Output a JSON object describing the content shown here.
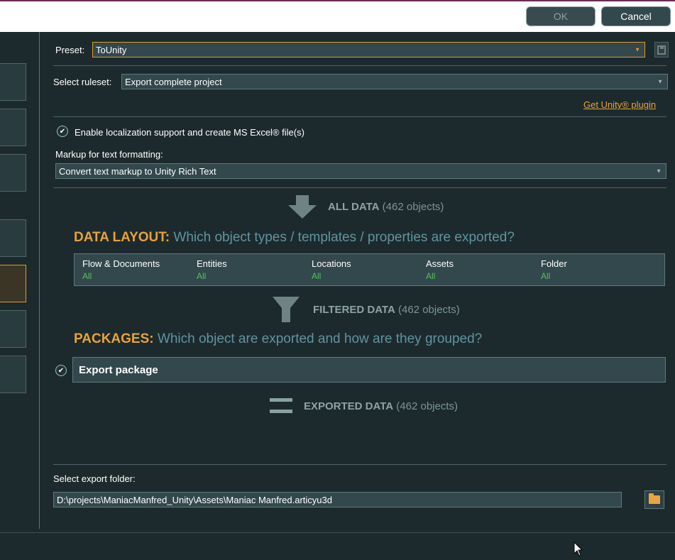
{
  "window": {
    "minimize_glyph": "−",
    "close_glyph": "✕"
  },
  "preset": {
    "label": "Preset:",
    "value": "ToUnity"
  },
  "ruleset": {
    "label": "Select ruleset:",
    "value": "Export complete project",
    "plugin_link": "Get Unity® plugin"
  },
  "localization": {
    "checkbox_label": "Enable localization support and create MS Excel® file(s)",
    "checked": true,
    "markup_label": "Markup for text formatting:",
    "markup_value": "Convert text markup to Unity Rich Text"
  },
  "flow": {
    "all_data_bold": "ALL DATA",
    "all_data_count": "(462 objects)",
    "filtered_bold": "FILTERED DATA",
    "filtered_count": "(462 objects)",
    "exported_bold": "EXPORTED DATA",
    "exported_count": "(462 objects)"
  },
  "data_layout": {
    "heading_bold": "DATA LAYOUT:",
    "heading_text": "Which object types / templates / properties are exported?",
    "columns": [
      {
        "header": "Flow & Documents",
        "value": "All"
      },
      {
        "header": "Entities",
        "value": "All"
      },
      {
        "header": "Locations",
        "value": "All"
      },
      {
        "header": "Assets",
        "value": "All"
      },
      {
        "header": "Folder",
        "value": "All"
      }
    ]
  },
  "packages": {
    "heading_bold": "PACKAGES:",
    "heading_text": "Which object are exported and how are they grouped?",
    "package_name": "Export package",
    "checked": true
  },
  "export_folder": {
    "label": "Select export folder:",
    "path": "D:\\projects\\ManiacManfred_Unity\\Assets\\Maniac Manfred.articyu3d"
  },
  "buttons": {
    "ok": "OK",
    "cancel": "Cancel"
  },
  "colors": {
    "accent": "#e8a23a",
    "heading_teal": "#5f94a1",
    "value_green": "#56c05a",
    "background": "#1d2a2d"
  }
}
